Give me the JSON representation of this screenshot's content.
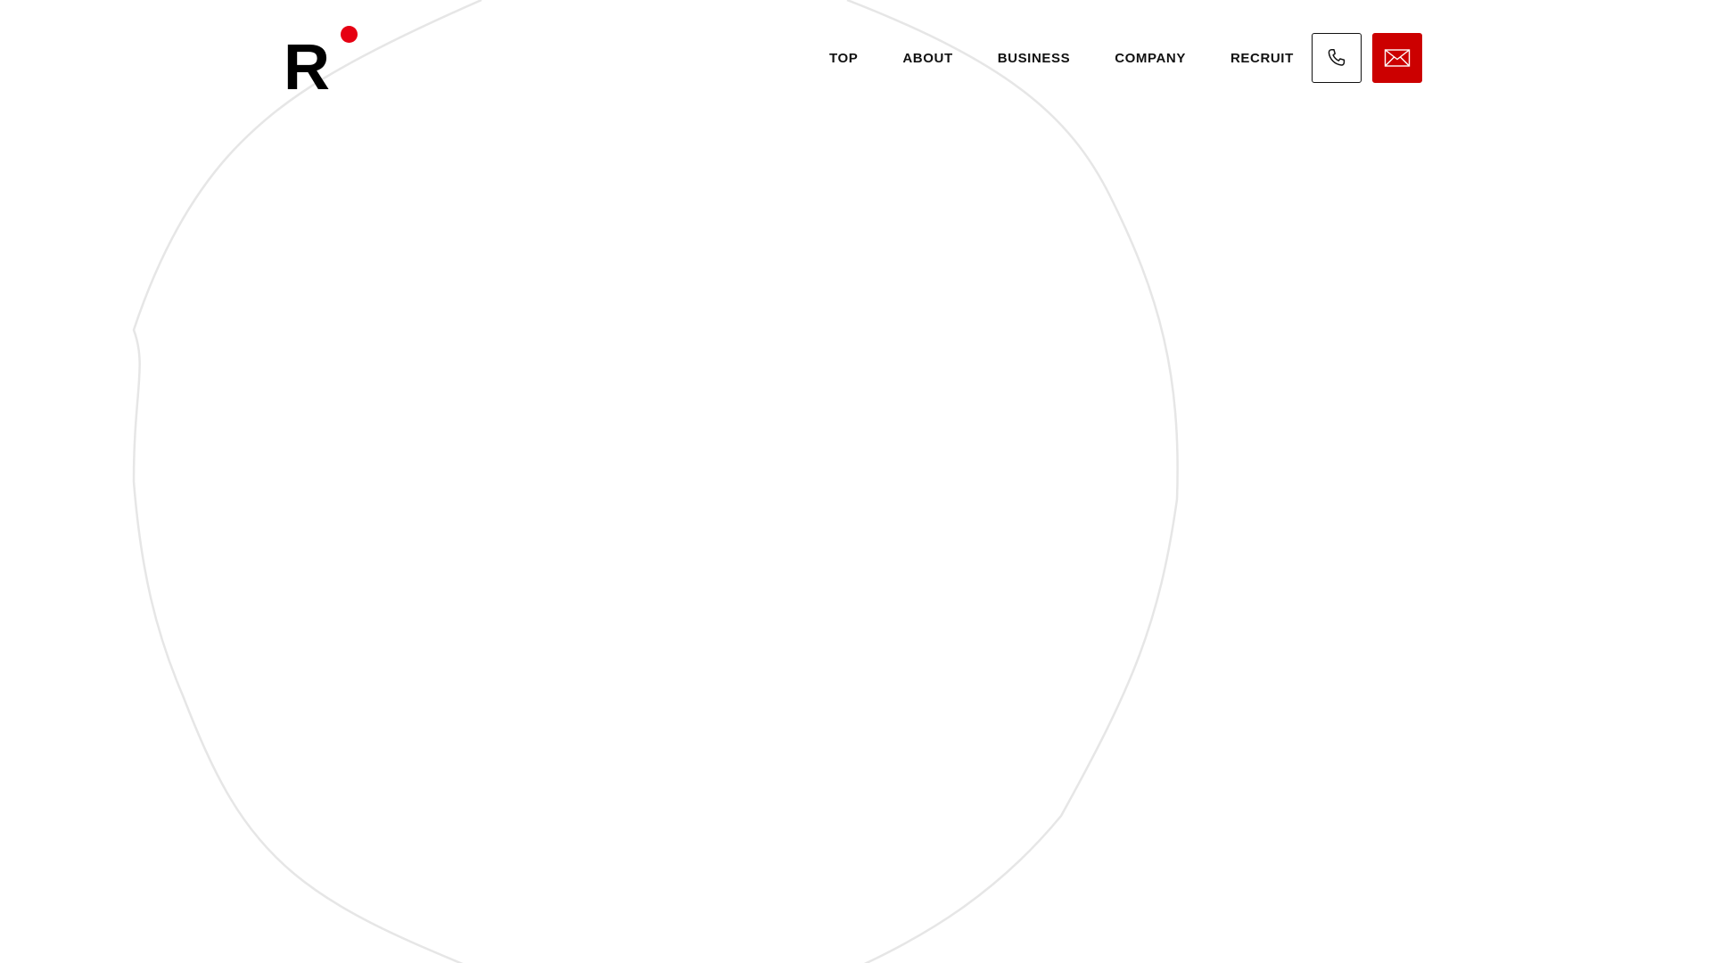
{
  "logo": {
    "letter": "R",
    "dot_color": "#e60012"
  },
  "nav": {
    "items": [
      {
        "label": "TOP"
      },
      {
        "label": "ABOUT"
      },
      {
        "label": "BUSINESS"
      },
      {
        "label": "COMPANY"
      },
      {
        "label": "RECRUIT"
      }
    ]
  },
  "actions": {
    "phone_icon": "phone-icon",
    "mail_icon": "mail-icon",
    "mail_bg_color": "#cc0000"
  },
  "colors": {
    "background": "#ffffff",
    "text": "#111111",
    "accent": "#cc0000",
    "blob_stroke": "#e6e6e6"
  }
}
